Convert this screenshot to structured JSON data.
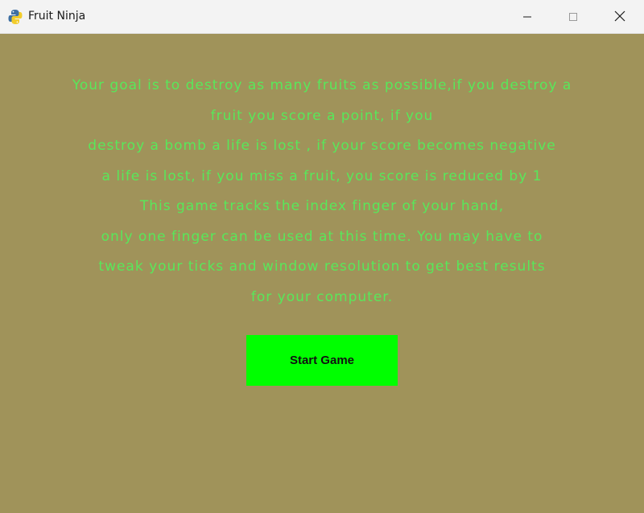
{
  "window": {
    "title": "Fruit Ninja",
    "app_icon": "python-icon",
    "controls": {
      "minimize_icon": "minimize-icon",
      "maximize_icon": "maximize-icon",
      "close_icon": "close-icon"
    }
  },
  "instructions": {
    "lines": [
      "Your goal is to destroy as many fruits as possible,if you destroy a",
      "fruit you score a point, if you",
      "destroy a bomb a life is lost , if your score becomes negative",
      "a life is lost, if you miss a fruit, you score is reduced by 1",
      "This game tracks the index finger of your hand,",
      "only one finger can be used at this time. You may have to",
      "tweak your ticks and window resolution to get best results",
      "for your computer."
    ]
  },
  "start_button": {
    "label": "Start Game"
  },
  "colors": {
    "background": "#a0935a",
    "text": "#58e85a",
    "button": "#00ff00",
    "button_text": "#111111",
    "titlebar": "#f3f3f3"
  }
}
